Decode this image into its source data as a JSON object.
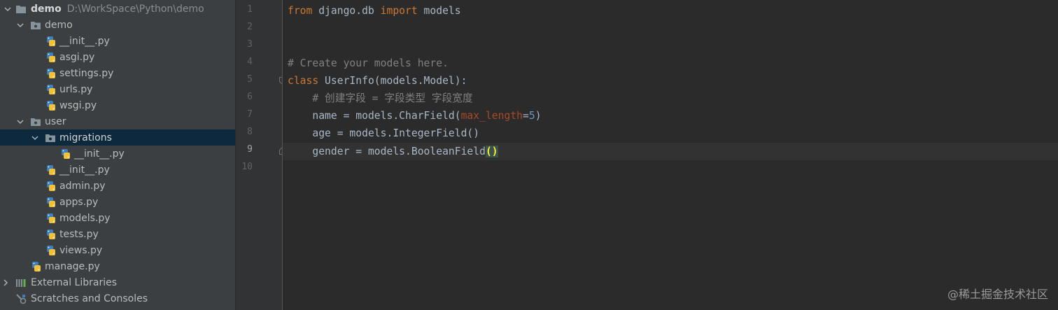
{
  "project_tree": {
    "root": {
      "label": "demo",
      "path": "D:\\WorkSpace\\Python\\demo"
    },
    "items": [
      {
        "label": "demo"
      },
      {
        "label": "__init__.py"
      },
      {
        "label": "asgi.py"
      },
      {
        "label": "settings.py"
      },
      {
        "label": "urls.py"
      },
      {
        "label": "wsgi.py"
      },
      {
        "label": "user"
      },
      {
        "label": "migrations"
      },
      {
        "label": "__init__.py"
      },
      {
        "label": "__init__.py"
      },
      {
        "label": "admin.py"
      },
      {
        "label": "apps.py"
      },
      {
        "label": "models.py"
      },
      {
        "label": "tests.py"
      },
      {
        "label": "views.py"
      },
      {
        "label": "manage.py"
      },
      {
        "label": "External Libraries"
      },
      {
        "label": "Scratches and Consoles"
      }
    ],
    "selected_item": "migrations"
  },
  "editor": {
    "line_numbers": [
      "1",
      "2",
      "3",
      "4",
      "5",
      "6",
      "7",
      "8",
      "9",
      "10"
    ],
    "current_line": "9",
    "lines": {
      "l1": {
        "kw_from": "from",
        "mod": " django.db ",
        "kw_import": "import",
        "name": " models"
      },
      "l4": {
        "comment": "# Create your models here."
      },
      "l5": {
        "kw_class": "class",
        "rest": " UserInfo(models.Model):"
      },
      "l6": {
        "comment": "    # 创建字段 = 字段类型 字段宽度"
      },
      "l7": {
        "pre": "    name = models.CharField(",
        "param": "max_length",
        "eq": "=",
        "num": "5",
        "post": ")"
      },
      "l8": {
        "text": "    age = models.IntegerField()"
      },
      "l9": {
        "pre": "    gender = models.BooleanField",
        "paren": "()"
      }
    }
  },
  "watermark": "@稀土掘金技术社区",
  "colors": {
    "keyword": "#cc7832",
    "comment": "#808080",
    "parameter": "#aa4926",
    "number": "#6897bb",
    "text": "#a9b7c6",
    "selection": "#0d293e",
    "python_blue": "#3d7fbf",
    "python_yellow": "#f0c23a"
  }
}
